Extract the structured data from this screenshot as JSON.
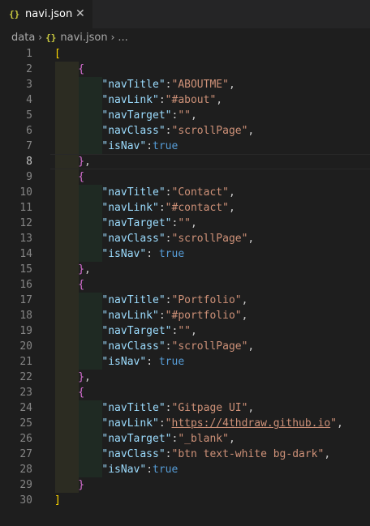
{
  "tab": {
    "icon": "{}",
    "label": "navi.json",
    "close": "✕"
  },
  "breadcrumb": {
    "items": [
      "data",
      "navi.json",
      "..."
    ],
    "separator": "›",
    "file_icon": "{}"
  },
  "editor": {
    "current_line": 8,
    "lines": [
      {
        "n": "1",
        "text": "["
      },
      {
        "n": "2",
        "text": "{"
      },
      {
        "n": "3",
        "key": "\"navTitle\"",
        "sep": ":",
        "val": "\"ABOUTME\"",
        "end": ","
      },
      {
        "n": "4",
        "key": "\"navLink\"",
        "sep": ":",
        "val": "\"#about\"",
        "end": ","
      },
      {
        "n": "5",
        "key": "\"navTarget\"",
        "sep": ":",
        "val": "\"\"",
        "end": ","
      },
      {
        "n": "6",
        "key": "\"navClass\"",
        "sep": ":",
        "val": "\"scrollPage\"",
        "end": ","
      },
      {
        "n": "7",
        "key": "\"isNav\"",
        "sep": ":",
        "val": "true",
        "end": ""
      },
      {
        "n": "8",
        "text": "},"
      },
      {
        "n": "9",
        "text": "{"
      },
      {
        "n": "10",
        "key": "\"navTitle\"",
        "sep": ":",
        "val": "\"Contact\"",
        "end": ","
      },
      {
        "n": "11",
        "key": "\"navLink\"",
        "sep": ":",
        "val": "\"#contact\"",
        "end": ","
      },
      {
        "n": "12",
        "key": "\"navTarget\"",
        "sep": ":",
        "val": "\"\"",
        "end": ","
      },
      {
        "n": "13",
        "key": "\"navClass\"",
        "sep": ":",
        "val": "\"scrollPage\"",
        "end": ","
      },
      {
        "n": "14",
        "key": "\"isNav\"",
        "sep": ": ",
        "val": "true",
        "end": ""
      },
      {
        "n": "15",
        "text": "},"
      },
      {
        "n": "16",
        "text": "{"
      },
      {
        "n": "17",
        "key": "\"navTitle\"",
        "sep": ":",
        "val": "\"Portfolio\"",
        "end": ","
      },
      {
        "n": "18",
        "key": "\"navLink\"",
        "sep": ":",
        "val": "\"#portfolio\"",
        "end": ","
      },
      {
        "n": "19",
        "key": "\"navTarget\"",
        "sep": ":",
        "val": "\"\"",
        "end": ","
      },
      {
        "n": "20",
        "key": "\"navClass\"",
        "sep": ":",
        "val": "\"scrollPage\"",
        "end": ","
      },
      {
        "n": "21",
        "key": "\"isNav\"",
        "sep": ": ",
        "val": "true",
        "end": ""
      },
      {
        "n": "22",
        "text": "},"
      },
      {
        "n": "23",
        "text": "{"
      },
      {
        "n": "24",
        "key": "\"navTitle\"",
        "sep": ":",
        "val": "\"Gitpage UI\"",
        "end": ","
      },
      {
        "n": "25",
        "key": "\"navLink\"",
        "sep": ":",
        "val": "\"https://4thdraw.github.io\"",
        "end": ",",
        "link": "https://4thdraw.github.io"
      },
      {
        "n": "26",
        "key": "\"navTarget\"",
        "sep": ":",
        "val": "\"_blank\"",
        "end": ","
      },
      {
        "n": "27",
        "key": "\"navClass\"",
        "sep": ":",
        "val": "\"btn text-white bg-dark\"",
        "end": ","
      },
      {
        "n": "28",
        "key": "\"isNav\"",
        "sep": ":",
        "val": "true",
        "end": ""
      },
      {
        "n": "29",
        "text": "}"
      },
      {
        "n": "30",
        "text": "]"
      }
    ]
  }
}
